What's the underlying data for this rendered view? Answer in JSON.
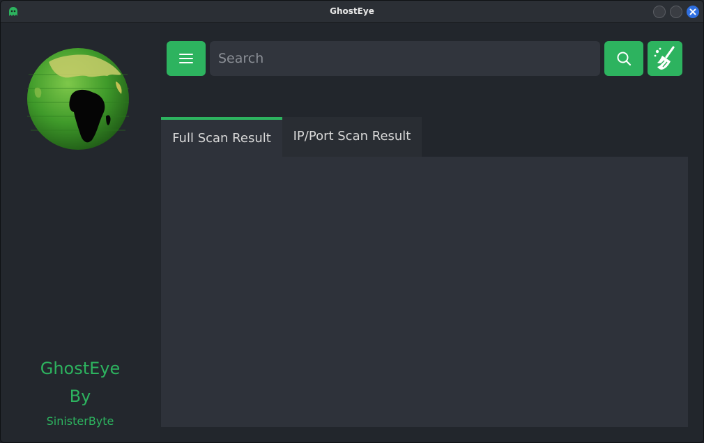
{
  "window": {
    "title": "GhostEye",
    "app_icon": "ghost-icon"
  },
  "sidebar": {
    "logo": "globe-logo",
    "app_name": "GhostEye",
    "by_label": "By",
    "author": "SinisterByte"
  },
  "toolbar": {
    "menu_icon": "hamburger-icon",
    "search_placeholder": "Search",
    "search_value": "",
    "search_icon": "search-icon",
    "clear_icon": "broom-icon"
  },
  "tabs": [
    {
      "label": "Full Scan Result",
      "active": true
    },
    {
      "label": "IP/Port Scan Result",
      "active": false
    }
  ],
  "colors": {
    "accent": "#2db35f",
    "background": "#22262c",
    "panel": "#2e323a",
    "close_button": "#2f6fe0"
  }
}
